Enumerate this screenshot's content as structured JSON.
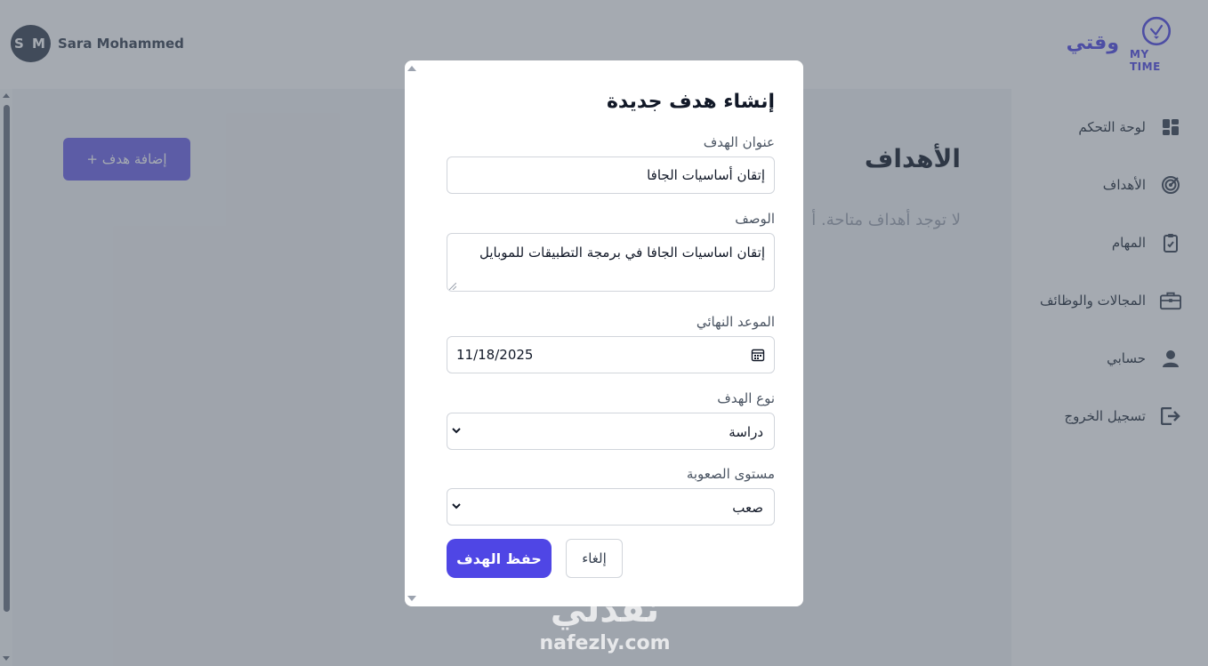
{
  "header": {
    "user_initials": "S M",
    "user_name": "Sara Mohammed",
    "brand": "وقتي",
    "logo_text": "MY TIME"
  },
  "sidebar": {
    "items": [
      {
        "label": "لوحة التحكم",
        "icon": "dashboard-icon"
      },
      {
        "label": "الأهداف",
        "icon": "target-icon"
      },
      {
        "label": "المهام",
        "icon": "clipboard-icon"
      },
      {
        "label": "المجالات والوظائف",
        "icon": "briefcase-icon"
      },
      {
        "label": "حسابي",
        "icon": "user-icon"
      },
      {
        "label": "تسجيل الخروج",
        "icon": "logout-icon"
      }
    ]
  },
  "main": {
    "add_goal_label": "+ إضافة هدف",
    "page_title": "الأهداف",
    "empty_text": "لا توجد أهداف متاحة. أ"
  },
  "modal": {
    "title": "إنشاء هدف جديدة",
    "goal_title_label": "عنوان الهدف",
    "goal_title_value": "إتقان أساسيات الجافا",
    "description_label": "الوصف",
    "description_value": "إتقان اساسيات الجافا في برمجة التطبيقات للموبايل",
    "deadline_label": "الموعد النهائي",
    "deadline_value": "11/18/2025",
    "goal_type_label": "نوع الهدف",
    "goal_type_value": "دراسة",
    "difficulty_label": "مستوى الصعوبة",
    "difficulty_value": "صعب",
    "save_label": "حفظ الهدف",
    "cancel_label": "إلغاء"
  },
  "watermark": {
    "arabic": "نفذلي",
    "latin": "nafezly.com"
  },
  "colors": {
    "accent": "#4f46e5",
    "add_button": "#6d62e8",
    "overlay": "rgba(75,85,99,0.5)"
  }
}
